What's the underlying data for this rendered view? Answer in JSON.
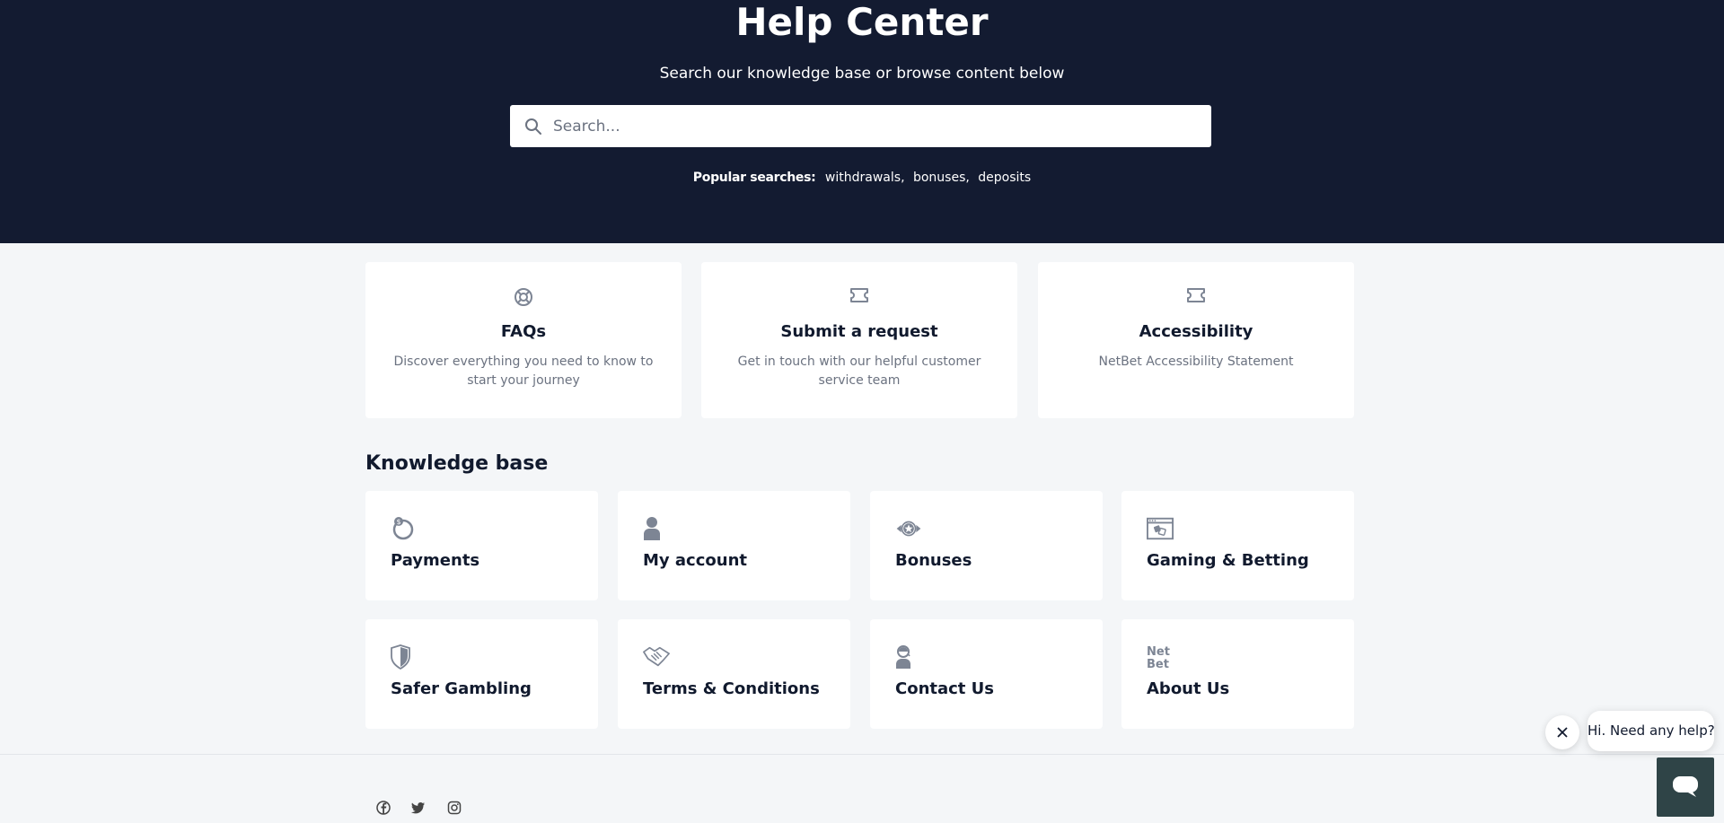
{
  "hero": {
    "title": "Help Center",
    "subtitle": "Search our knowledge base or browse content below",
    "search_placeholder": "Search...",
    "popular_label": "Popular searches:",
    "popular": [
      "withdrawals",
      "bonuses",
      "deposits"
    ]
  },
  "top_cards": [
    {
      "icon": "lifebuoy-icon",
      "title": "FAQs",
      "desc": "Discover everything you need to know to start your journey"
    },
    {
      "icon": "ticket-icon",
      "title": "Submit a request",
      "desc": "Get in touch with our helpful customer service team"
    },
    {
      "icon": "ticket-icon",
      "title": "Accessibility",
      "desc": "NetBet Accessibility Statement"
    }
  ],
  "knowledge_base": {
    "heading": "Knowledge base",
    "items": [
      {
        "icon": "coin-hand-icon",
        "label": "Payments"
      },
      {
        "icon": "user-icon",
        "label": "My account"
      },
      {
        "icon": "star-badge-icon",
        "label": "Bonuses"
      },
      {
        "icon": "browser-game-icon",
        "label": "Gaming & Betting"
      },
      {
        "icon": "shield-icon",
        "label": "Safer Gambling"
      },
      {
        "icon": "handshake-icon",
        "label": "Terms & Conditions"
      },
      {
        "icon": "agent-icon",
        "label": "Contact Us"
      },
      {
        "icon": "netbet-logo-icon",
        "label": "About Us"
      }
    ]
  },
  "chat": {
    "bubble": "Hi. Need any help?"
  },
  "colors": {
    "hero_bg": "#131b31",
    "page_bg": "#f4f6f8",
    "icon": "#7d8594",
    "chat_button": "#2f4447"
  }
}
